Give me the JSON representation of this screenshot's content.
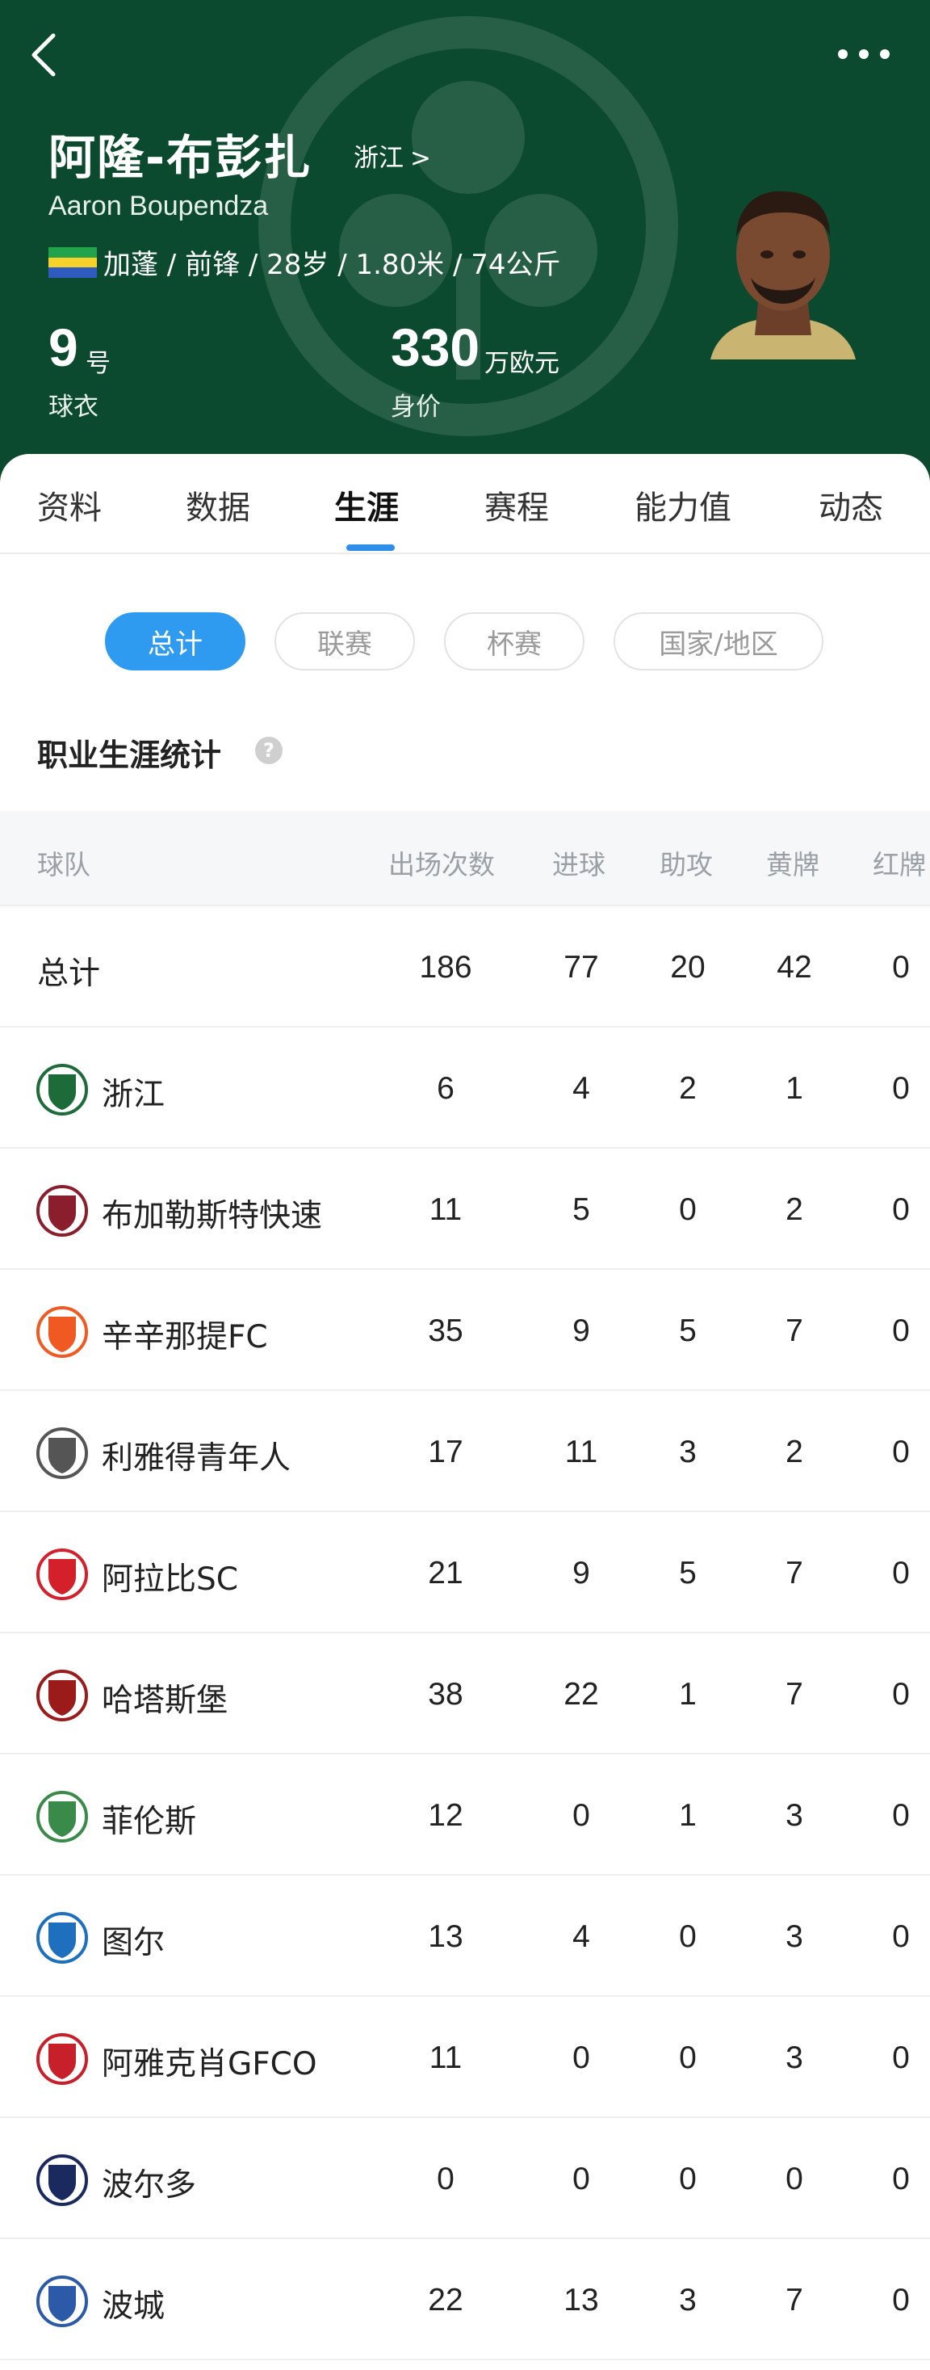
{
  "player": {
    "name_cn": "阿隆-布彭扎",
    "name_en": "Aaron Boupendza",
    "club": "浙江",
    "club_arrow": ">",
    "meta": "加蓬 / 前锋 / 28岁 / 1.80米 / 74公斤",
    "shirt_number": "9",
    "shirt_unit": "号",
    "shirt_label": "球衣",
    "value": "330",
    "value_unit": "万欧元",
    "value_label": "身价"
  },
  "icons": {
    "back": "chevron-left-icon",
    "more": "more-dots-icon",
    "help": "question-icon"
  },
  "tabs": [
    "资料",
    "数据",
    "生涯",
    "赛程",
    "能力值",
    "动态"
  ],
  "active_tab": "生涯",
  "filters": [
    "总计",
    "联赛",
    "杯赛",
    "国家/地区"
  ],
  "active_filter": "总计",
  "help_glyph": "?",
  "section_title": "职业生涯统计",
  "table": {
    "headers": [
      "球队",
      "出场次数",
      "进球",
      "助攻",
      "黄牌",
      "红牌"
    ],
    "total": {
      "label": "总计",
      "values": [
        "186",
        "77",
        "20",
        "42",
        "0"
      ]
    },
    "rows": [
      {
        "team": "浙江",
        "apps": "6",
        "goals": "4",
        "assists": "2",
        "yellow": "1",
        "red": "0",
        "logo_color": "#1e6b3a"
      },
      {
        "team": "布加勒斯特快速",
        "apps": "11",
        "goals": "5",
        "assists": "0",
        "yellow": "2",
        "red": "0",
        "logo_color": "#8b1e2d"
      },
      {
        "team": "辛辛那提FC",
        "apps": "35",
        "goals": "9",
        "assists": "5",
        "yellow": "7",
        "red": "0",
        "logo_color": "#f05a22"
      },
      {
        "team": "利雅得青年人",
        "apps": "17",
        "goals": "11",
        "assists": "3",
        "yellow": "2",
        "red": "0",
        "logo_color": "#555555"
      },
      {
        "team": "阿拉比SC",
        "apps": "21",
        "goals": "9",
        "assists": "5",
        "yellow": "7",
        "red": "0",
        "logo_color": "#d4202a"
      },
      {
        "team": "哈塔斯堡",
        "apps": "38",
        "goals": "22",
        "assists": "1",
        "yellow": "7",
        "red": "0",
        "logo_color": "#9b1b1b"
      },
      {
        "team": "菲伦斯",
        "apps": "12",
        "goals": "0",
        "assists": "1",
        "yellow": "3",
        "red": "0",
        "logo_color": "#3a8a4a"
      },
      {
        "team": "图尔",
        "apps": "13",
        "goals": "4",
        "assists": "0",
        "yellow": "3",
        "red": "0",
        "logo_color": "#1f6fbf"
      },
      {
        "team": "阿雅克肖GFCO",
        "apps": "11",
        "goals": "0",
        "assists": "0",
        "yellow": "3",
        "red": "0",
        "logo_color": "#c8202a"
      },
      {
        "team": "波尔多",
        "apps": "0",
        "goals": "0",
        "assists": "0",
        "yellow": "0",
        "red": "0",
        "logo_color": "#1b2a5e"
      },
      {
        "team": "波城",
        "apps": "22",
        "goals": "13",
        "assists": "3",
        "yellow": "7",
        "red": "0",
        "logo_color": "#2c5aa8"
      }
    ]
  },
  "colors": {
    "header_bg": "#0c4a2f",
    "accent": "#2f9bf0",
    "tab_indicator": "#2f8ee8"
  }
}
